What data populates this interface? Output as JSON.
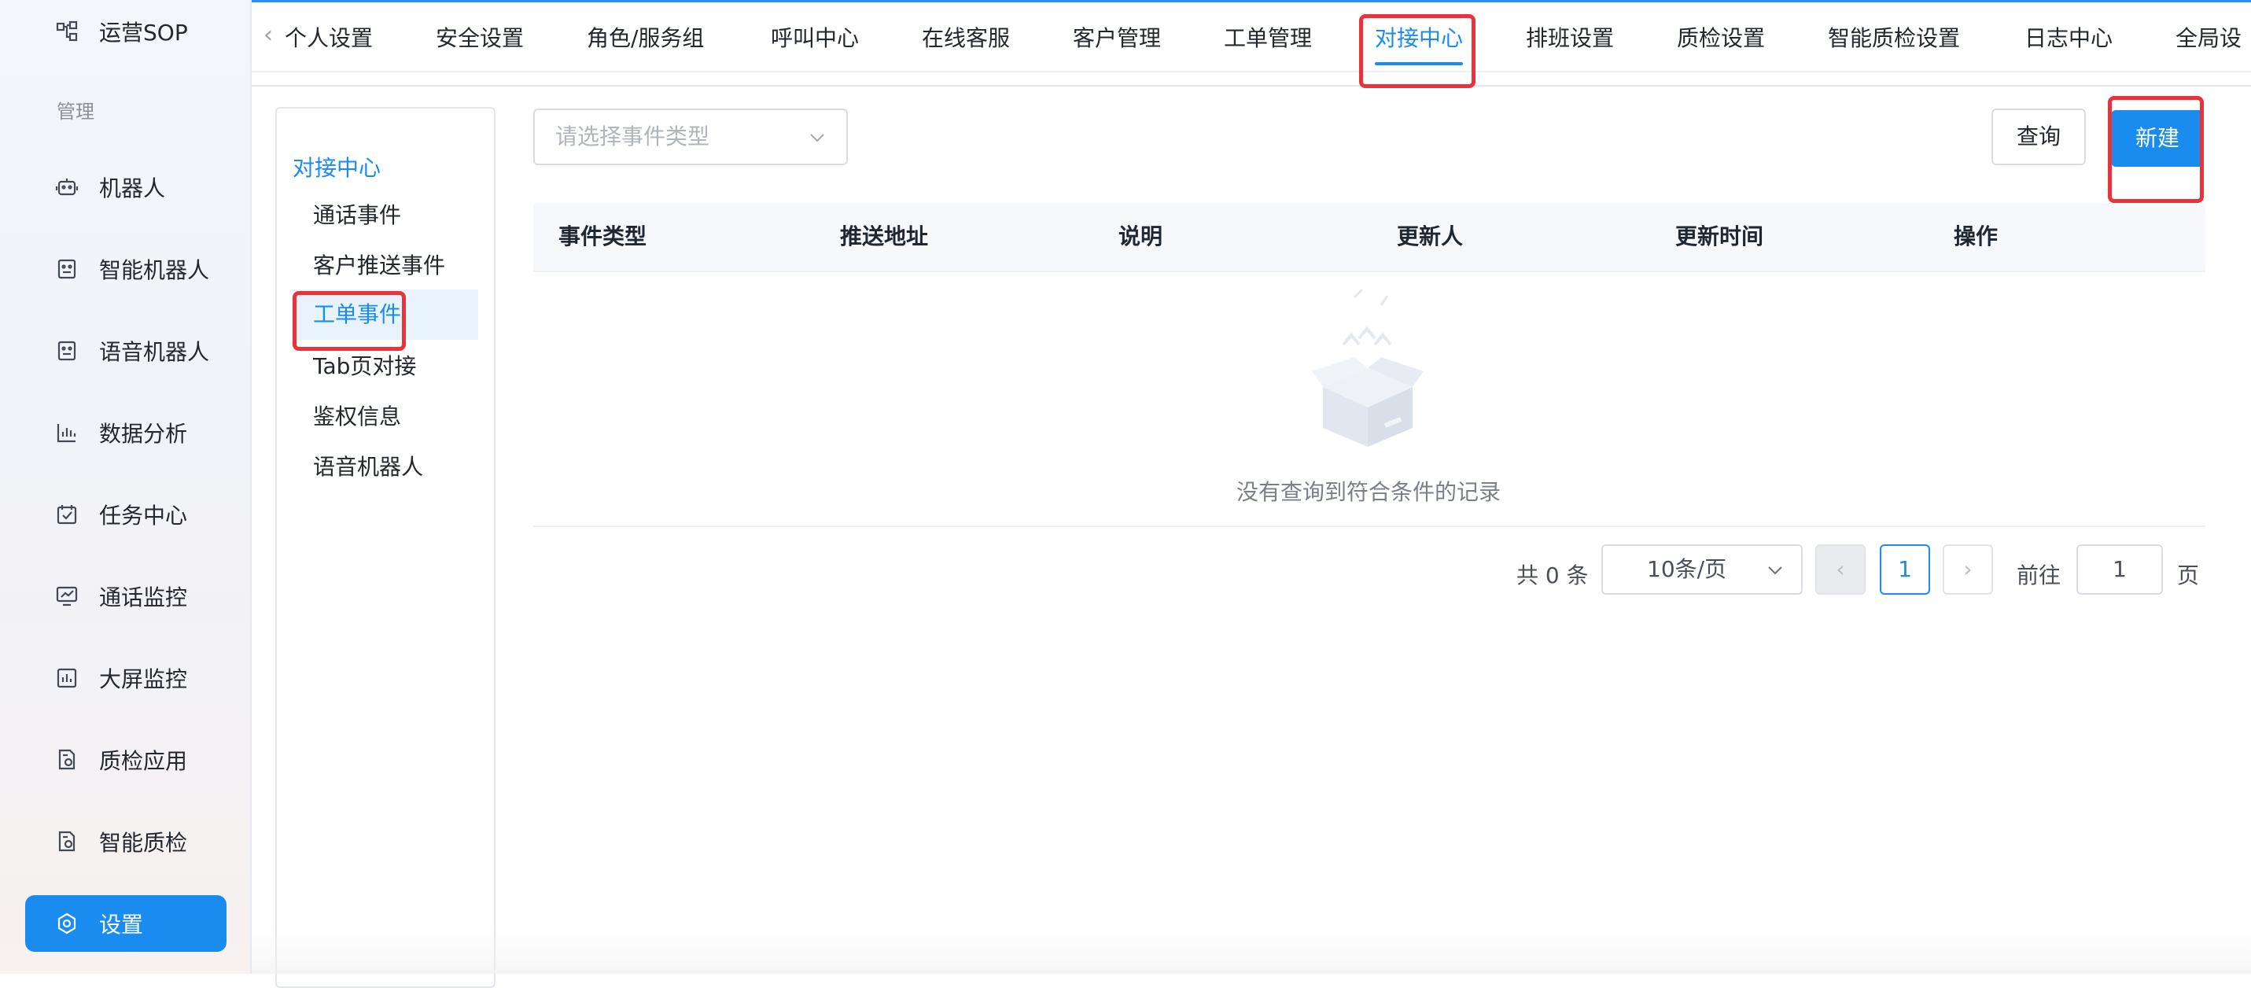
{
  "sidebar": {
    "top_item": {
      "label": "运营SOP",
      "icon": "flow-icon"
    },
    "group_label": "管理",
    "items": [
      {
        "label": "机器人",
        "icon": "robot-icon"
      },
      {
        "label": "智能机器人",
        "icon": "smart-robot-icon"
      },
      {
        "label": "语音机器人",
        "icon": "voice-robot-icon"
      },
      {
        "label": "数据分析",
        "icon": "bar-chart-icon"
      },
      {
        "label": "任务中心",
        "icon": "calendar-check-icon"
      },
      {
        "label": "通话监控",
        "icon": "monitor-icon"
      },
      {
        "label": "大屏监控",
        "icon": "dashboard-icon"
      },
      {
        "label": "质检应用",
        "icon": "inspection-icon"
      },
      {
        "label": "智能质检",
        "icon": "smart-inspection-icon"
      }
    ],
    "active_item": {
      "label": "设置",
      "icon": "settings-icon"
    }
  },
  "tabs": [
    "个人设置",
    "安全设置",
    "角色/服务组",
    "呼叫中心",
    "在线客服",
    "客户管理",
    "工单管理",
    "对接中心",
    "排班设置",
    "质检设置",
    "智能质检设置",
    "日志中心",
    "全局设"
  ],
  "active_tab": "对接中心",
  "submenu": {
    "title": "对接中心",
    "items": [
      "通话事件",
      "客户推送事件",
      "工单事件",
      "Tab页对接",
      "鉴权信息",
      "语音机器人"
    ],
    "active": "工单事件"
  },
  "filter": {
    "placeholder": "请选择事件类型"
  },
  "buttons": {
    "query": "查询",
    "new": "新建"
  },
  "table": {
    "columns": [
      "事件类型",
      "推送地址",
      "说明",
      "更新人",
      "更新时间",
      "操作"
    ],
    "rows": [],
    "empty_text": "没有查询到符合条件的记录"
  },
  "pagination": {
    "total_text": "共 0 条",
    "page_size": "10条/页",
    "prev": "‹",
    "current": "1",
    "next": "›",
    "goto_label": "前往",
    "goto_value": "1",
    "page_suffix": "页"
  },
  "colors": {
    "accent": "#1a8cf0",
    "highlight": "#e8333b"
  }
}
